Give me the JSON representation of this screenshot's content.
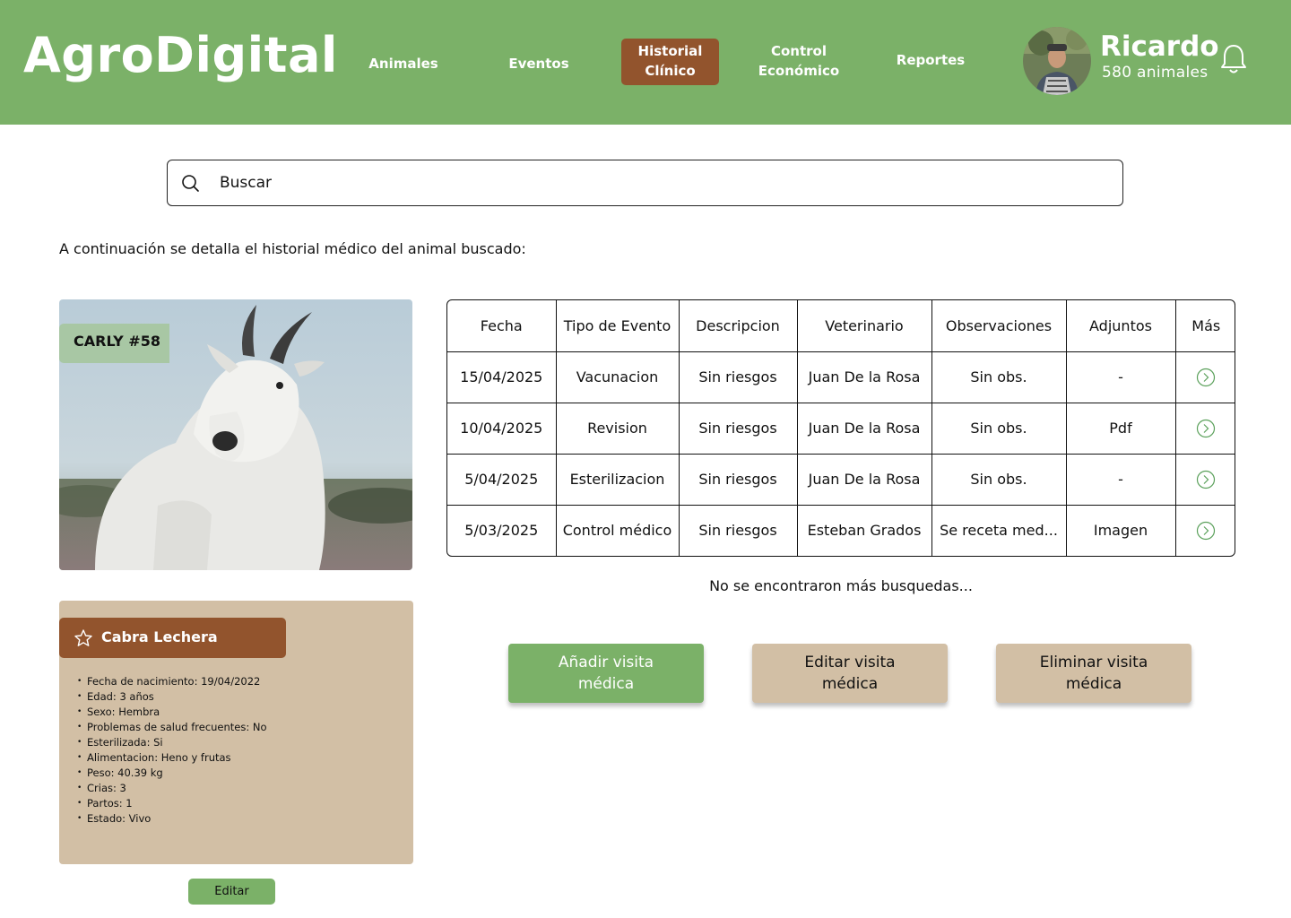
{
  "app": {
    "logo": "AgroDigital"
  },
  "nav": {
    "animales": "Animales",
    "eventos": "Eventos",
    "historial_line1": "Historial",
    "historial_line2": "Clínico",
    "control_line1": "Control",
    "control_line2": "Económico",
    "reportes": "Reportes"
  },
  "user": {
    "name": "Ricardo",
    "count": "580 animales"
  },
  "search": {
    "placeholder": "Buscar"
  },
  "intro": "A continuación se detalla el historial médico del animal buscado:",
  "animal": {
    "tag": "CARLY #58",
    "breed": "Cabra Lechera",
    "details": [
      "Fecha de nacimiento: 19/04/2022",
      "Edad: 3 años",
      "Sexo: Hembra",
      "Problemas de salud frecuentes: No",
      "Esterilizada: Si",
      "Alimentacion: Heno y frutas",
      "Peso: 40.39 kg",
      "Crias: 3",
      "Partos: 1",
      "Estado: Vivo"
    ],
    "edit_label": "Editar"
  },
  "table": {
    "headers": [
      "Fecha",
      "Tipo de Evento",
      "Descripcion",
      "Veterinario",
      "Observaciones",
      "Adjuntos",
      "Más"
    ],
    "rows": [
      [
        "15/04/2025",
        "Vacunacion",
        "Sin riesgos",
        "Juan De la Rosa",
        "Sin obs.",
        "-"
      ],
      [
        "10/04/2025",
        "Revision",
        "Sin riesgos",
        "Juan De la Rosa",
        "Sin obs.",
        "Pdf"
      ],
      [
        "5/04/2025",
        "Esterilizacion",
        "Sin riesgos",
        "Juan De la Rosa",
        "Sin obs.",
        "-"
      ],
      [
        "5/03/2025",
        "Control médico",
        "Sin riesgos",
        "Esteban Grados",
        "Se receta med...",
        "Imagen"
      ]
    ]
  },
  "no_more": "No se encontraron más busquedas...",
  "actions": {
    "add_line1": "Añadir visita",
    "add_line2": "médica",
    "edit_line1": "Editar visita",
    "edit_line2": "médica",
    "delete_line1": "Eliminar visita",
    "delete_line2": "médica"
  },
  "colors": {
    "header_green": "#7bb168",
    "accent_brown": "#92542d",
    "card_beige": "#d2bfa5",
    "tag_green": "#a8c7a4",
    "icon_green": "#5aa05a"
  }
}
